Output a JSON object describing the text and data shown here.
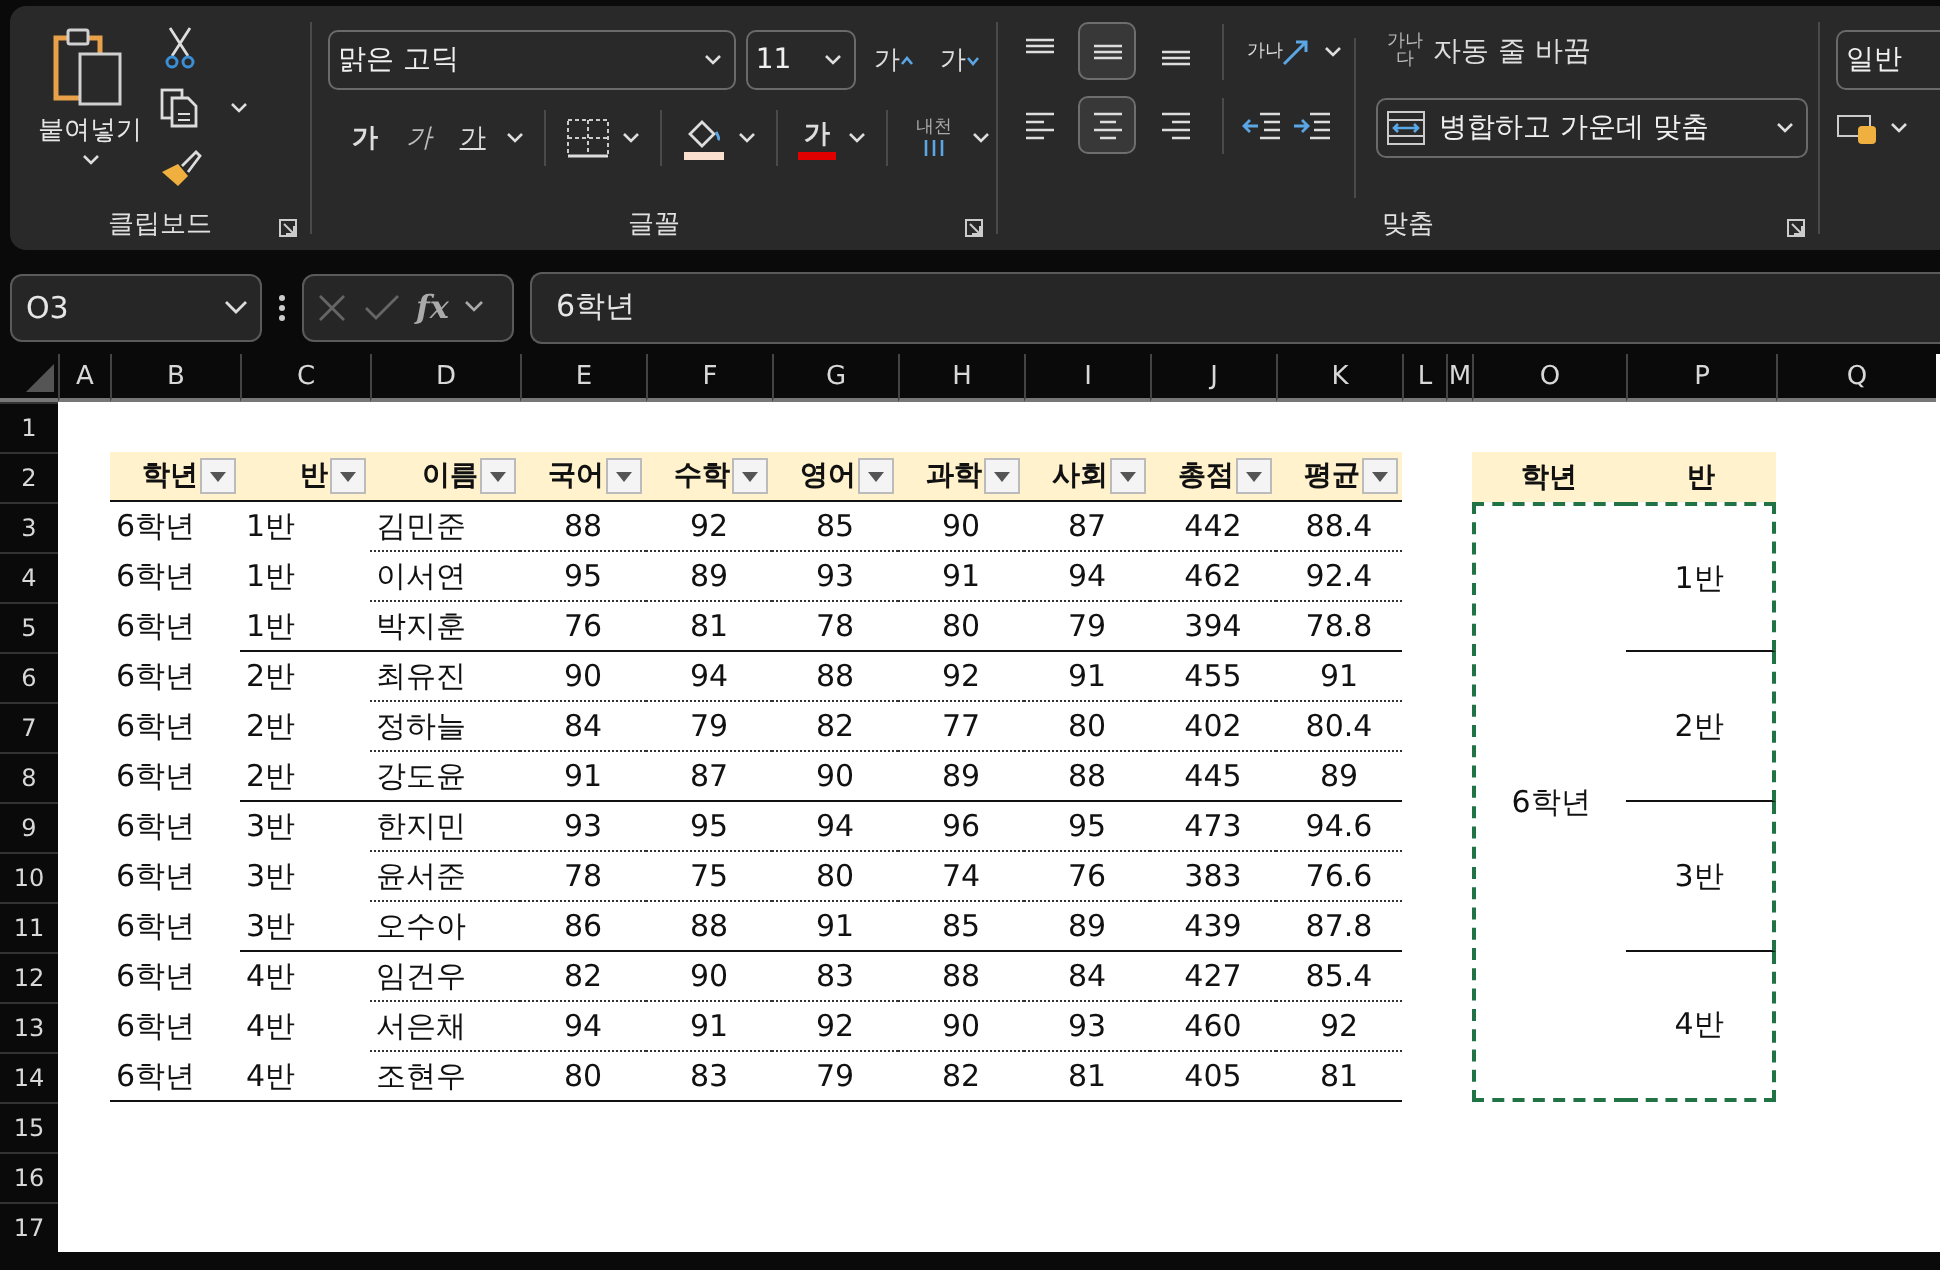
{
  "ribbon": {
    "clipboard": {
      "paste_label": "붙여넣기",
      "group_label": "클립보드"
    },
    "font": {
      "font_name": "맑은 고딕",
      "font_size": "11",
      "grow_label": "가",
      "shrink_label": "가",
      "style_buttons": [
        {
          "kind": "bold",
          "label": "가"
        },
        {
          "kind": "italic",
          "label": "가"
        },
        {
          "kind": "underline",
          "label": "가"
        }
      ],
      "font_color_label": "가",
      "phonetic_label": "내천",
      "group_label": "글꼴"
    },
    "alignment": {
      "vertical": [
        {
          "kind": "top",
          "selected": false
        },
        {
          "kind": "middle",
          "selected": true
        },
        {
          "kind": "bottom",
          "selected": false
        }
      ],
      "horizontal": [
        {
          "kind": "left",
          "selected": false
        },
        {
          "kind": "center",
          "selected": true
        },
        {
          "kind": "right",
          "selected": false
        }
      ],
      "orientation_label": "가나",
      "wrap_icon_label": "가나다",
      "wrap_label": "자동 줄 바꿈",
      "merge_label": "병합하고 가운데 맞춤",
      "group_label": "맞춤"
    },
    "number": {
      "format": "일반"
    }
  },
  "formula_bar": {
    "name_box": "O3",
    "fx_label": "fx",
    "formula": "6학년"
  },
  "sheet": {
    "columns": [
      "A",
      "B",
      "C",
      "D",
      "E",
      "F",
      "G",
      "H",
      "I",
      "J",
      "K",
      "L",
      "M",
      "O",
      "P",
      "Q"
    ],
    "rows": [
      "1",
      "2",
      "3",
      "4",
      "5",
      "6",
      "7",
      "8",
      "9",
      "10",
      "11",
      "12",
      "13",
      "14",
      "15",
      "16",
      "17"
    ],
    "table": {
      "headers": [
        "학년",
        "반",
        "이름",
        "국어",
        "수학",
        "영어",
        "과학",
        "사회",
        "총점",
        "평균"
      ],
      "rows": [
        {
          "grade": "6학년",
          "class": "1반",
          "name": "김민준",
          "scores": [
            "88",
            "92",
            "85",
            "90",
            "87"
          ],
          "total": "442",
          "average": "88.4",
          "group_end": false
        },
        {
          "grade": "6학년",
          "class": "1반",
          "name": "이서연",
          "scores": [
            "95",
            "89",
            "93",
            "91",
            "94"
          ],
          "total": "462",
          "average": "92.4",
          "group_end": false
        },
        {
          "grade": "6학년",
          "class": "1반",
          "name": "박지훈",
          "scores": [
            "76",
            "81",
            "78",
            "80",
            "79"
          ],
          "total": "394",
          "average": "78.8",
          "group_end": true
        },
        {
          "grade": "6학년",
          "class": "2반",
          "name": "최유진",
          "scores": [
            "90",
            "94",
            "88",
            "92",
            "91"
          ],
          "total": "455",
          "average": "91",
          "group_end": false
        },
        {
          "grade": "6학년",
          "class": "2반",
          "name": "정하늘",
          "scores": [
            "84",
            "79",
            "82",
            "77",
            "80"
          ],
          "total": "402",
          "average": "80.4",
          "group_end": false
        },
        {
          "grade": "6학년",
          "class": "2반",
          "name": "강도윤",
          "scores": [
            "91",
            "87",
            "90",
            "89",
            "88"
          ],
          "total": "445",
          "average": "89",
          "group_end": true
        },
        {
          "grade": "6학년",
          "class": "3반",
          "name": "한지민",
          "scores": [
            "93",
            "95",
            "94",
            "96",
            "95"
          ],
          "total": "473",
          "average": "94.6",
          "group_end": false
        },
        {
          "grade": "6학년",
          "class": "3반",
          "name": "윤서준",
          "scores": [
            "78",
            "75",
            "80",
            "74",
            "76"
          ],
          "total": "383",
          "average": "76.6",
          "group_end": false
        },
        {
          "grade": "6학년",
          "class": "3반",
          "name": "오수아",
          "scores": [
            "86",
            "88",
            "91",
            "85",
            "89"
          ],
          "total": "439",
          "average": "87.8",
          "group_end": true
        },
        {
          "grade": "6학년",
          "class": "4반",
          "name": "임건우",
          "scores": [
            "82",
            "90",
            "83",
            "88",
            "84"
          ],
          "total": "427",
          "average": "85.4",
          "group_end": false
        },
        {
          "grade": "6학년",
          "class": "4반",
          "name": "서은채",
          "scores": [
            "94",
            "91",
            "92",
            "90",
            "93"
          ],
          "total": "460",
          "average": "92",
          "group_end": false
        },
        {
          "grade": "6학년",
          "class": "4반",
          "name": "조현우",
          "scores": [
            "80",
            "83",
            "79",
            "82",
            "81"
          ],
          "total": "405",
          "average": "81",
          "group_end": true
        }
      ]
    },
    "summary": {
      "headers": [
        "학년",
        "반"
      ],
      "grade": "6학년",
      "classes": [
        "1반",
        "2반",
        "3반",
        "4반"
      ]
    }
  }
}
